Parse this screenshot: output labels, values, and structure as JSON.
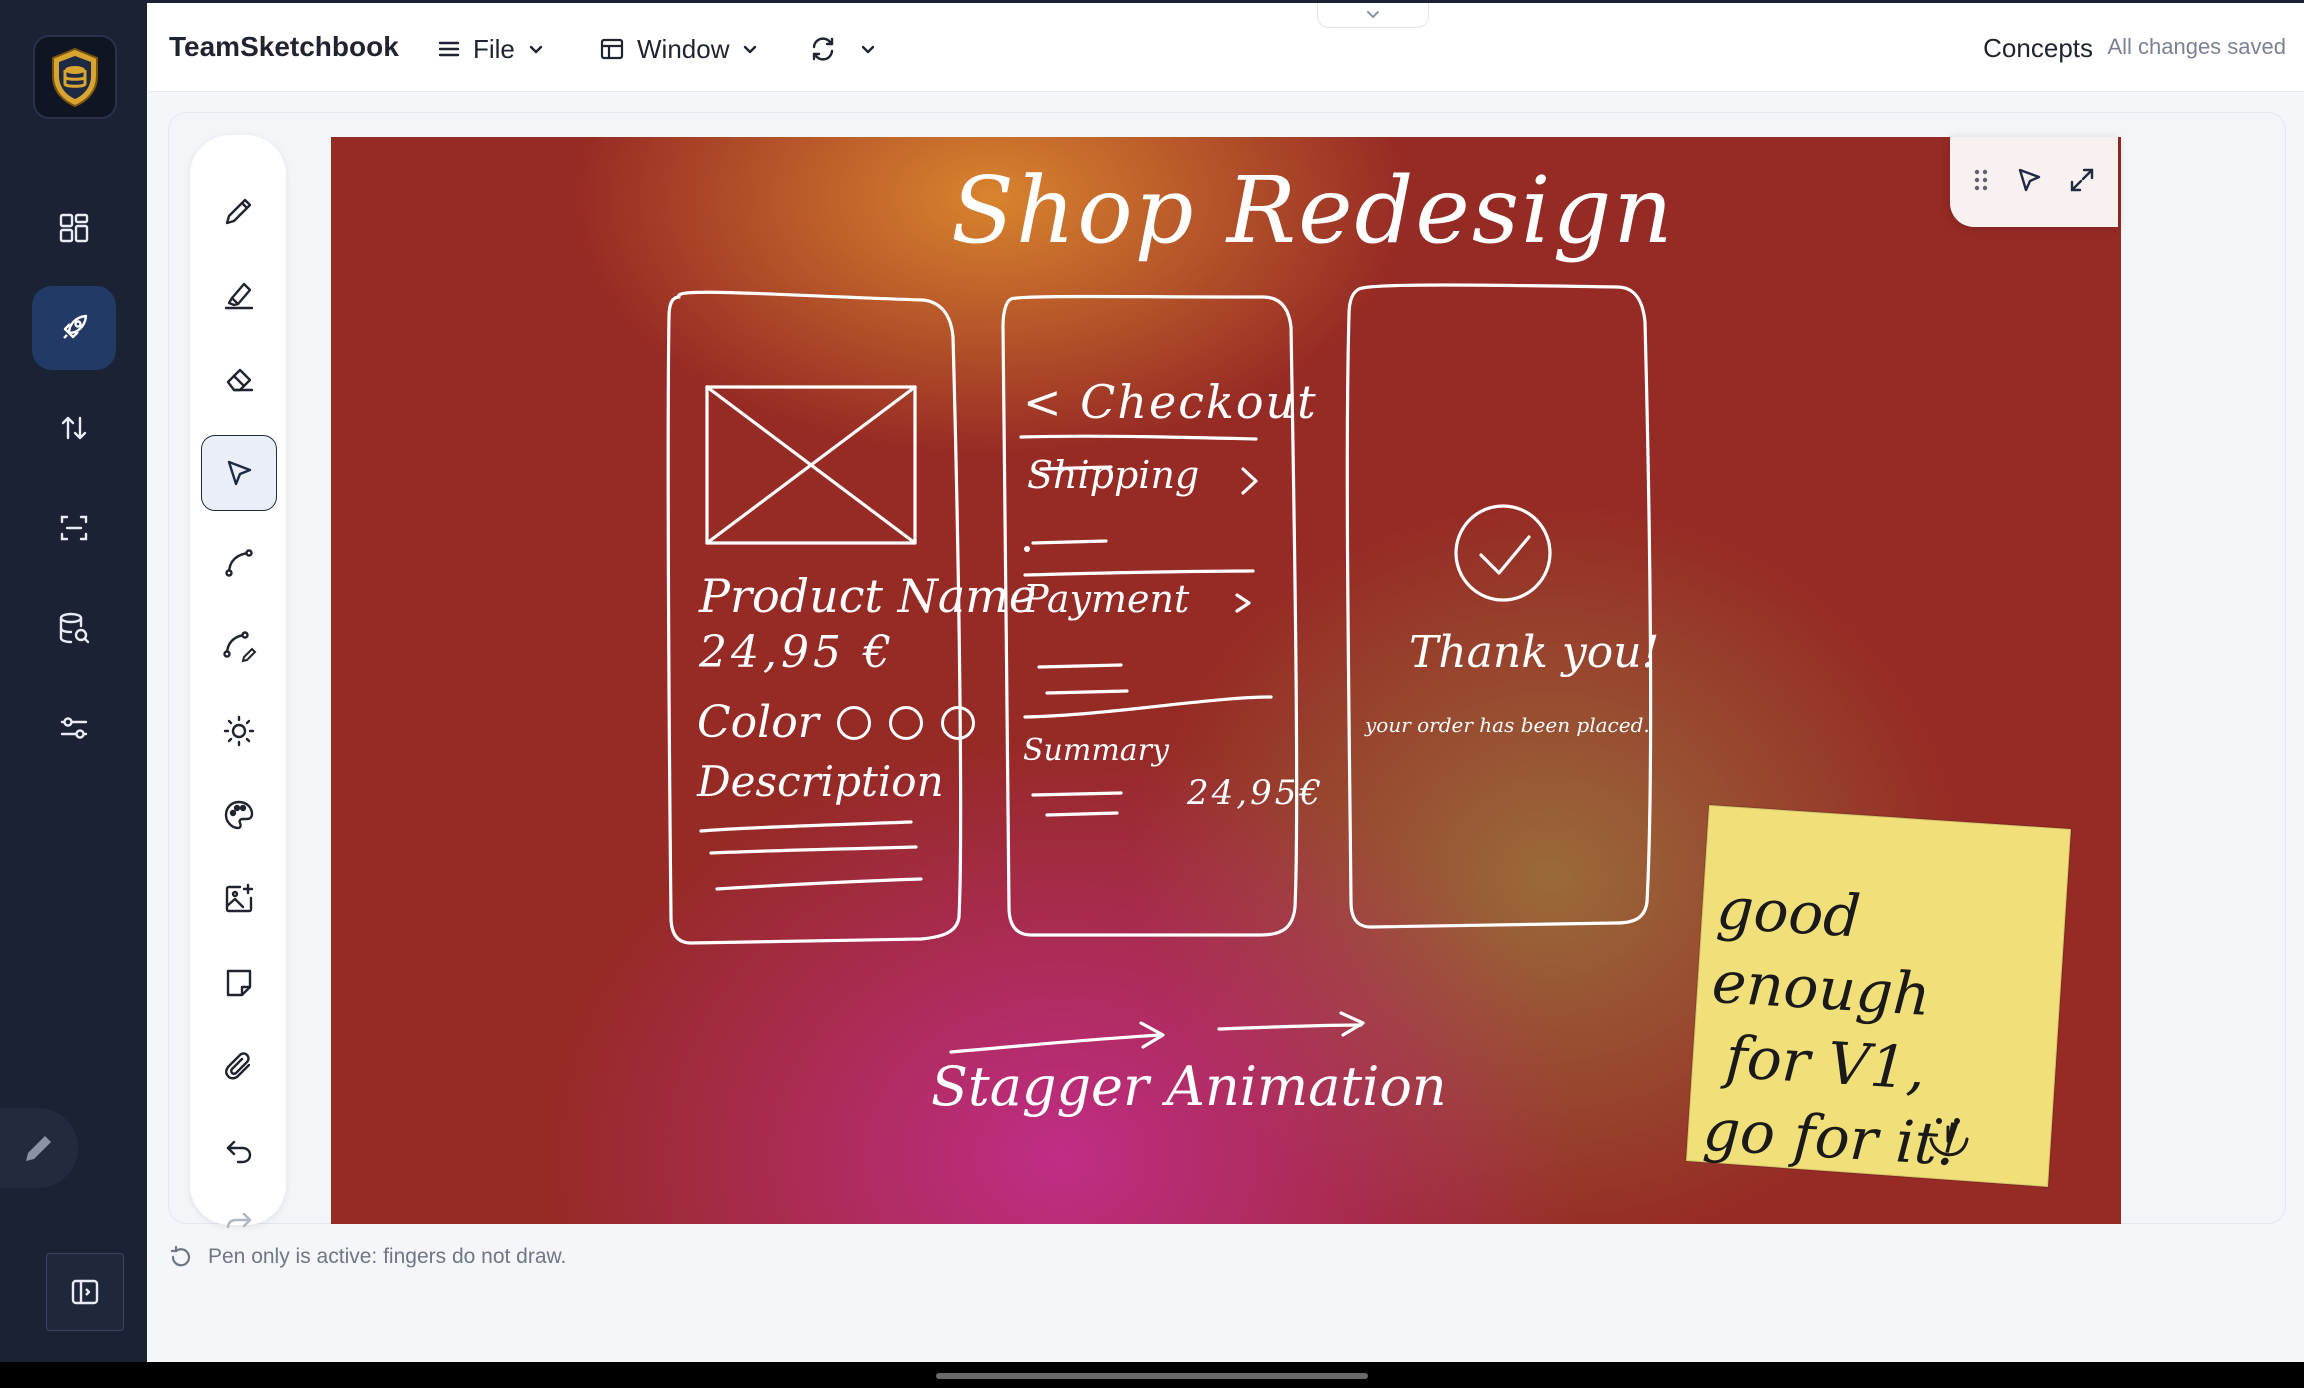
{
  "header": {
    "app_title": "TeamSketchbook",
    "file_menu": "File",
    "window_menu": "Window",
    "section_title": "Concepts",
    "save_status": "All changes saved"
  },
  "sketch": {
    "title": "Shop Redesign",
    "screen1": {
      "product_name": "Product Name",
      "price": "24,95 €",
      "color_label": "Color",
      "description": "Description"
    },
    "screen2": {
      "header": "< Checkout",
      "shipping": "Shipping",
      "payment": "Payment",
      "summary": "Summary",
      "total": "24,95€"
    },
    "screen3": {
      "thanks": "Thank you!",
      "message": "your order has been placed."
    },
    "animation_label": "Stagger Animation",
    "note_lines": [
      "good enough",
      "for V1,",
      "go for it!"
    ]
  },
  "status_bar": {
    "message": "Pen only is active: fingers do not draw."
  },
  "colors": {
    "rail": "#1a2234",
    "rail_active": "#223a66",
    "canvas_base": "#962a25",
    "sticky_note": "#f4e27a"
  }
}
